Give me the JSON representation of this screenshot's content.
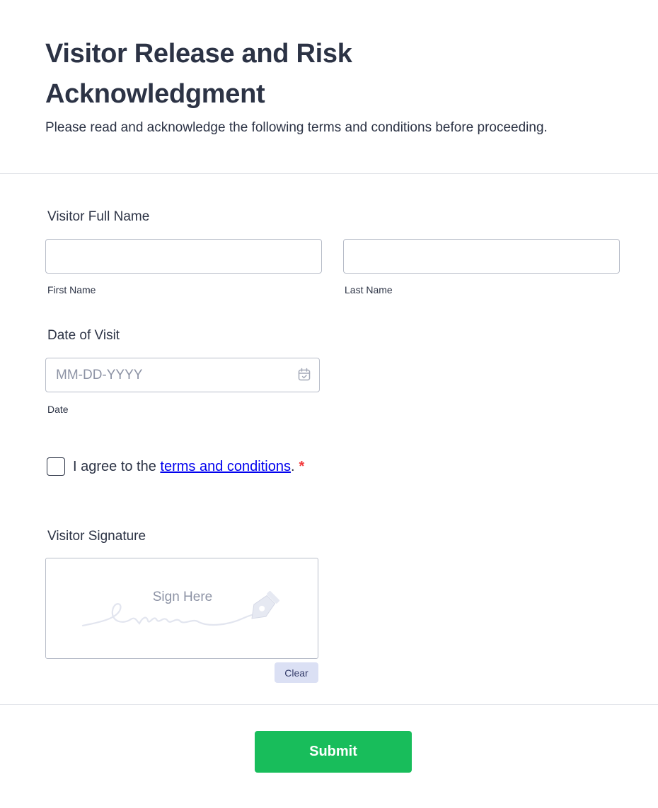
{
  "header": {
    "title": "Visitor Release and Risk Acknowledgment",
    "subtitle": "Please read and acknowledge the following terms and conditions before proceeding."
  },
  "name_field": {
    "label": "Visitor Full Name",
    "first": {
      "value": "",
      "sublabel": "First Name"
    },
    "last": {
      "value": "",
      "sublabel": "Last Name"
    }
  },
  "date_field": {
    "label": "Date of Visit",
    "placeholder": "MM-DD-YYYY",
    "value": "",
    "sublabel": "Date",
    "icon": "calendar-icon"
  },
  "agreement": {
    "checked": false,
    "prefix": "I agree to the ",
    "link_text": "terms and conditions",
    "suffix": ".",
    "required_mark": "*"
  },
  "signature": {
    "label": "Visitor Signature",
    "hint": "Sign Here",
    "icon": "pen-nib-icon",
    "clear_label": "Clear"
  },
  "footer": {
    "submit_label": "Submit"
  },
  "colors": {
    "text": "#2c3345",
    "border": "#b8bdc9",
    "submit": "#18bd5b",
    "clear_bg": "#dbe0f4",
    "required": "#f23a3c",
    "link": "#0000ee"
  }
}
